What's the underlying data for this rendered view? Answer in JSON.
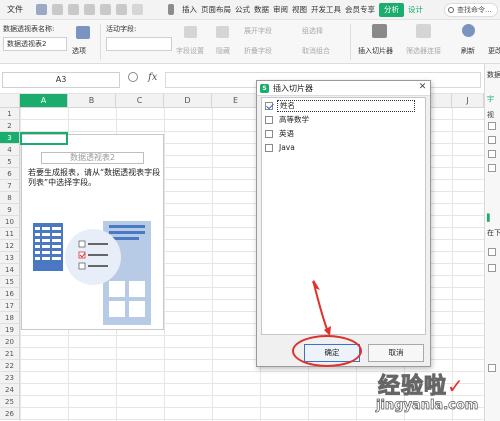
{
  "titlebar": {
    "file_menu": "文件",
    "tabs": [
      {
        "label": "插入",
        "active": false
      },
      {
        "label": "页面布局",
        "active": false
      },
      {
        "label": "公式",
        "active": false
      },
      {
        "label": "数据",
        "active": false
      },
      {
        "label": "审阅",
        "active": false
      },
      {
        "label": "视图",
        "active": false
      },
      {
        "label": "开发工具",
        "active": false
      },
      {
        "label": "会员专享",
        "active": false
      },
      {
        "label": "分析",
        "active": true
      },
      {
        "label": "设计",
        "active": false
      }
    ],
    "search": "查找命令..."
  },
  "ribbon": {
    "pivot_name_label": "数据透视表名称:",
    "pivot_name_value": "数据透视表2",
    "options_label": "选项",
    "active_field_label": "活动字段:",
    "active_field_value": "",
    "field_settings": "字段设置",
    "hide": "隐藏",
    "expand_field": "展开字段",
    "collapse_field": "折叠字段",
    "group_selection": "组选择",
    "ungroup": "取消组合",
    "insert_slicer": "插入切片器",
    "filter_connections": "筛选器连接",
    "refresh": "刷新",
    "more": "更改"
  },
  "formula_bar": {
    "name_box": "A3",
    "fx": "fx",
    "formula": ""
  },
  "grid": {
    "columns": [
      "A",
      "B",
      "C",
      "D",
      "E",
      "F",
      "G",
      "H",
      "I",
      "J"
    ],
    "selected_column": "A",
    "rows": [
      "1",
      "2",
      "3",
      "4",
      "5",
      "6",
      "7",
      "8",
      "9",
      "10",
      "11",
      "12",
      "13",
      "14",
      "15",
      "16",
      "17",
      "18",
      "19",
      "20",
      "21",
      "22",
      "23",
      "24",
      "25",
      "26"
    ],
    "selected_row": "3"
  },
  "pivot": {
    "title": "数据透视表2",
    "hint": "若要生成报表，请从“数据透视表字段列表”中选择字段。"
  },
  "right_panel": {
    "label1": "数据",
    "label2": "宇",
    "label3": "视",
    "label4": "在下"
  },
  "dialog": {
    "title": "插入切片器",
    "items": [
      {
        "label": "姓名",
        "checked": true
      },
      {
        "label": "高等数学",
        "checked": false
      },
      {
        "label": "英语",
        "checked": false
      },
      {
        "label": "Java",
        "checked": false
      }
    ],
    "ok": "确定",
    "cancel": "取消"
  },
  "watermark": {
    "text": "经验啦",
    "check": "✓",
    "url": "jingyanla.com"
  },
  "colors": {
    "accent": "#1aad6d",
    "annotation_red": "#e0322d"
  }
}
